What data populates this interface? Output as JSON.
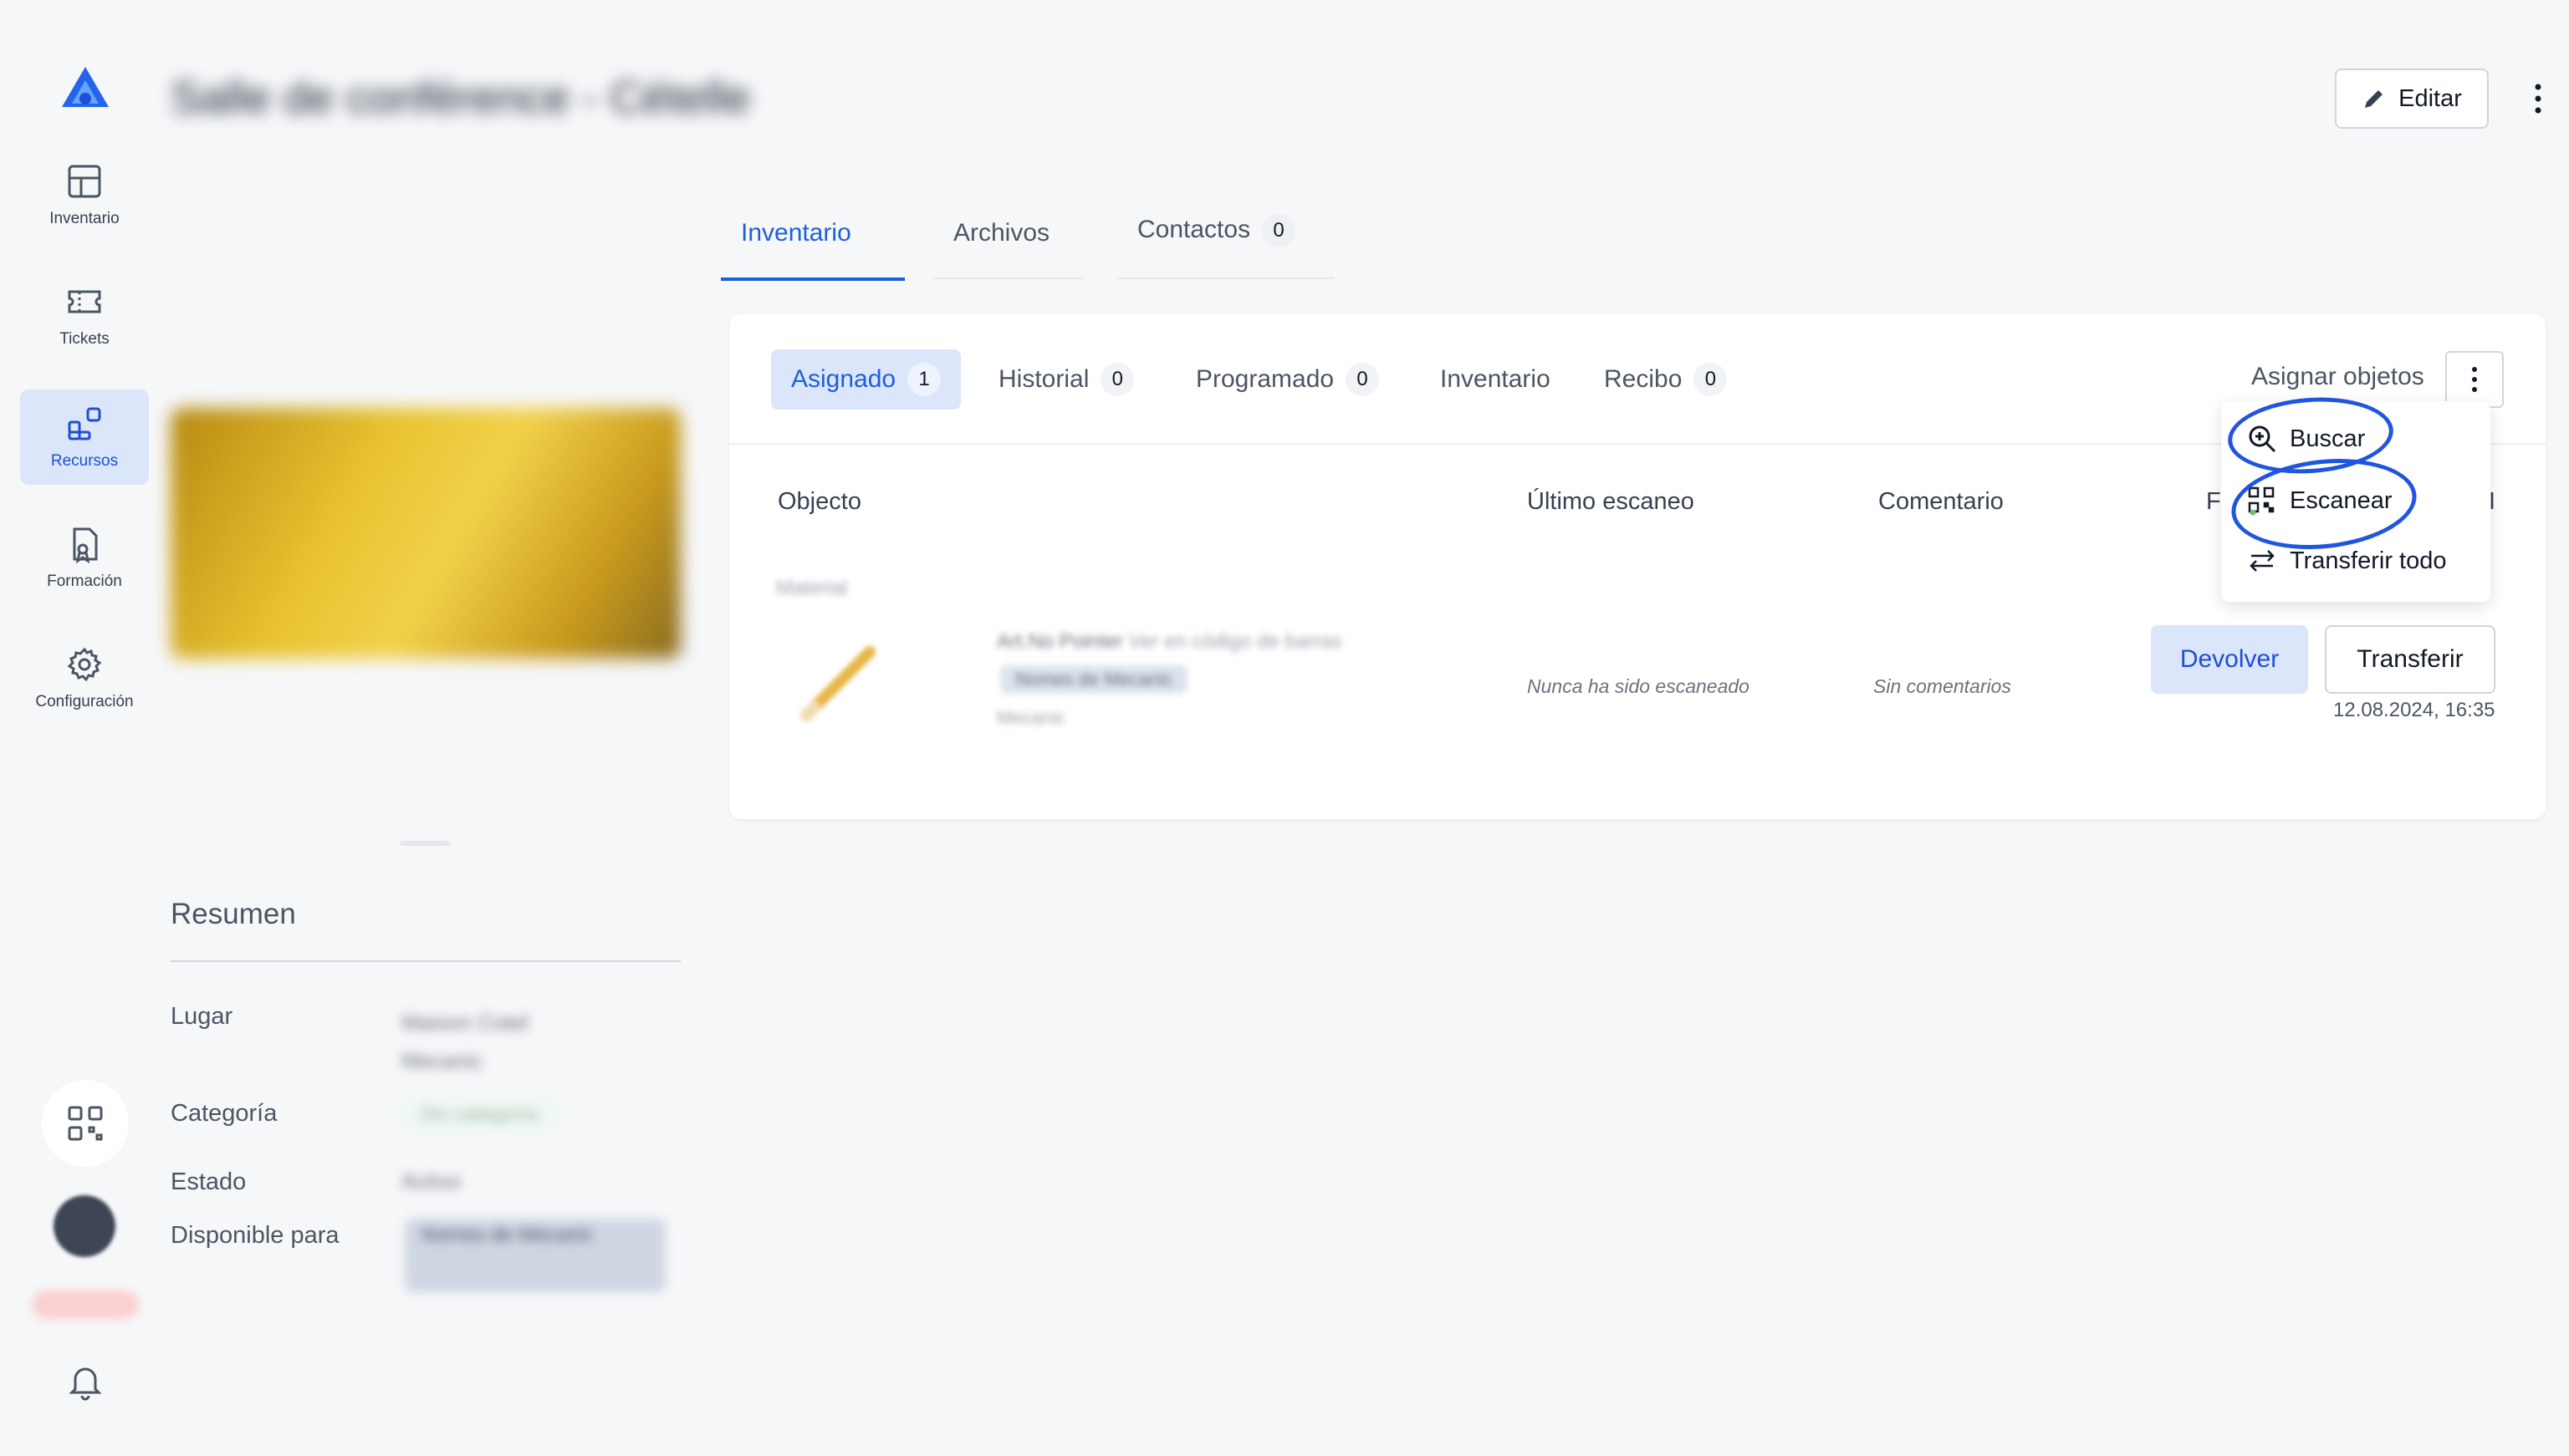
{
  "sidebar": {
    "items": [
      {
        "label": "Inventario",
        "icon": "grid-icon"
      },
      {
        "label": "Tickets",
        "icon": "ticket-icon"
      },
      {
        "label": "Recursos",
        "icon": "resources-icon"
      },
      {
        "label": "Formación",
        "icon": "certificate-icon"
      },
      {
        "label": "Configuración",
        "icon": "gear-icon"
      }
    ],
    "active_index": 2
  },
  "header": {
    "title": "Salle de conférence - Cételle",
    "edit_label": "Editar"
  },
  "summary": {
    "title": "Resumen",
    "rows": [
      {
        "label": "Lugar",
        "value": "Maison Cotel Mecanic"
      },
      {
        "label": "Categoría",
        "value": "Sin categoría"
      },
      {
        "label": "Estado",
        "value": "Activo"
      },
      {
        "label": "Disponible para",
        "value": "Nomes de Mecanic"
      }
    ]
  },
  "main_tabs": [
    {
      "label": "Inventario"
    },
    {
      "label": "Archivos"
    },
    {
      "label": "Contactos",
      "count": "0"
    }
  ],
  "sub_tabs": [
    {
      "label": "Asignado",
      "count": "1"
    },
    {
      "label": "Historial",
      "count": "0"
    },
    {
      "label": "Programado",
      "count": "0"
    },
    {
      "label": "Inventario"
    },
    {
      "label": "Recibo",
      "count": "0"
    }
  ],
  "assign_label": "Asignar objetos",
  "table": {
    "headers": [
      "Objecto",
      "Último escaneo",
      "Comentario",
      "F",
      "I"
    ],
    "row": {
      "group": "Material",
      "name": "Art.No Pointer",
      "name_detail": "Ver en código de barras",
      "chip": "Nomes de Mecanic",
      "sub": "Mecanic",
      "last_scan": "Nunca ha sido escaneado",
      "comment": "Sin comentarios",
      "return_label": "Devolver",
      "transfer_label": "Transferir",
      "date": "12.08.2024, 16:35"
    }
  },
  "dropdown": {
    "items": [
      {
        "label": "Buscar",
        "icon": "zoom-in-icon"
      },
      {
        "label": "Escanear",
        "icon": "qr-scan-icon"
      },
      {
        "label": "Transferir todo",
        "icon": "transfer-arrows-icon"
      }
    ]
  },
  "colors": {
    "accent": "#1f5fd6",
    "accent_soft": "#dbe6fb",
    "annotation": "#1f55e0"
  }
}
